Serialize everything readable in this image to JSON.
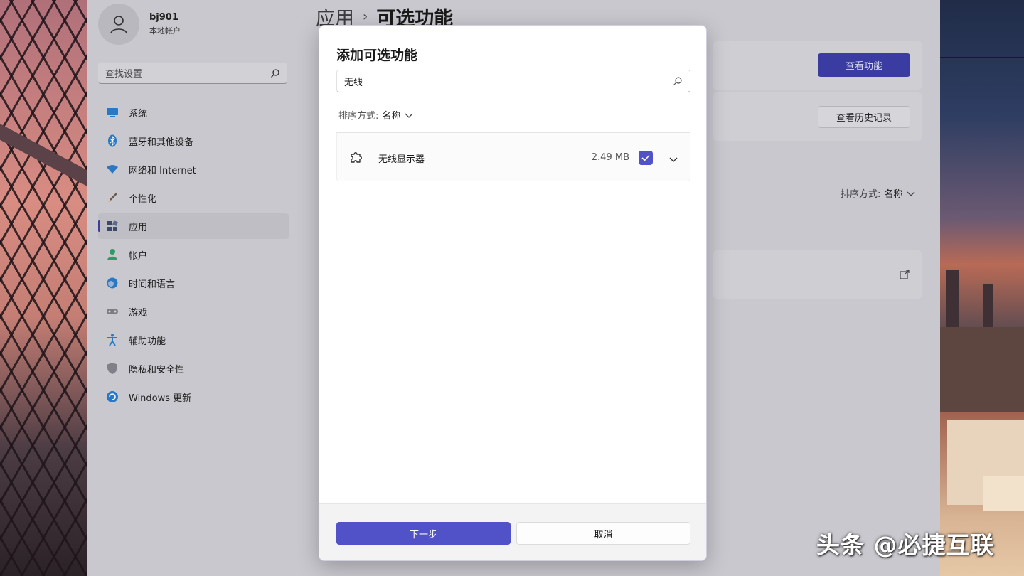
{
  "settings": {
    "profile": {
      "name": "bj901",
      "account_type": "本地帐户"
    },
    "search_placeholder": "查找设置",
    "nav": [
      {
        "label": "系统",
        "icon": "display-icon",
        "color": "#1f6fb8"
      },
      {
        "label": "蓝牙和其他设备",
        "icon": "bluetooth-icon",
        "color": "#1f6fb8"
      },
      {
        "label": "网络和 Internet",
        "icon": "wifi-icon",
        "color": "#1f6fb8"
      },
      {
        "label": "个性化",
        "icon": "brush-icon",
        "color": "#a46a3a"
      },
      {
        "label": "应用",
        "icon": "apps-icon",
        "color": "#3a4a6a",
        "active": true
      },
      {
        "label": "帐户",
        "icon": "person-icon",
        "color": "#2e8a5a"
      },
      {
        "label": "时间和语言",
        "icon": "globe-clock-icon",
        "color": "#1f6fb8"
      },
      {
        "label": "游戏",
        "icon": "gamepad-icon",
        "color": "#707078"
      },
      {
        "label": "辅助功能",
        "icon": "accessibility-icon",
        "color": "#1f6fb8"
      },
      {
        "label": "隐私和安全性",
        "icon": "shield-icon",
        "color": "#707078"
      },
      {
        "label": "Windows 更新",
        "icon": "update-icon",
        "color": "#1f6fb8"
      }
    ],
    "breadcrumb": {
      "parent": "应用",
      "separator": "›",
      "current": "可选功能"
    },
    "view_features_label": "查看功能",
    "view_history_label": "查看历史记录",
    "sort": {
      "label": "排序方式:",
      "value": "名称"
    }
  },
  "dialog": {
    "title": "添加可选功能",
    "search_value": "无线",
    "sort": {
      "label": "排序方式:",
      "value": "名称"
    },
    "features": [
      {
        "name": "无线显示器",
        "size": "2.49 MB",
        "checked": true
      }
    ],
    "next_label": "下一步",
    "cancel_label": "取消"
  },
  "watermark": "头条 @必捷互联",
  "colors": {
    "accent": "#5152c8"
  }
}
